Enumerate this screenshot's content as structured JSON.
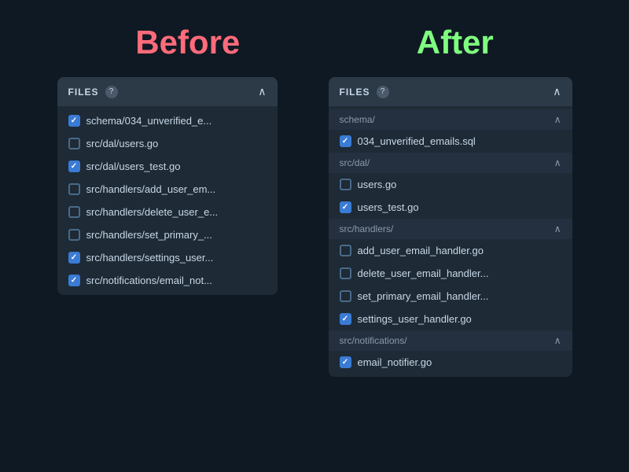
{
  "heading_before": "Before",
  "heading_after": "After",
  "panel_title": "FILES",
  "help_label": "?",
  "before_files": [
    {
      "name": "schema/034_unverified_e...",
      "checked": true
    },
    {
      "name": "src/dal/users.go",
      "checked": false
    },
    {
      "name": "src/dal/users_test.go",
      "checked": true
    },
    {
      "name": "src/handlers/add_user_em...",
      "checked": false
    },
    {
      "name": "src/handlers/delete_user_e...",
      "checked": false
    },
    {
      "name": "src/handlers/set_primary_...",
      "checked": false
    },
    {
      "name": "src/handlers/settings_user...",
      "checked": true
    },
    {
      "name": "src/notifications/email_not...",
      "checked": true
    }
  ],
  "after_sections": [
    {
      "name": "schema/",
      "files": [
        {
          "name": "034_unverified_emails.sql",
          "checked": true
        }
      ]
    },
    {
      "name": "src/dal/",
      "files": [
        {
          "name": "users.go",
          "checked": false
        },
        {
          "name": "users_test.go",
          "checked": true
        }
      ]
    },
    {
      "name": "src/handlers/",
      "files": [
        {
          "name": "add_user_email_handler.go",
          "checked": false
        },
        {
          "name": "delete_user_email_handler...",
          "checked": false
        },
        {
          "name": "set_primary_email_handler...",
          "checked": false
        },
        {
          "name": "settings_user_handler.go",
          "checked": true
        }
      ]
    },
    {
      "name": "src/notifications/",
      "files": [
        {
          "name": "email_notifier.go",
          "checked": true
        }
      ]
    }
  ]
}
